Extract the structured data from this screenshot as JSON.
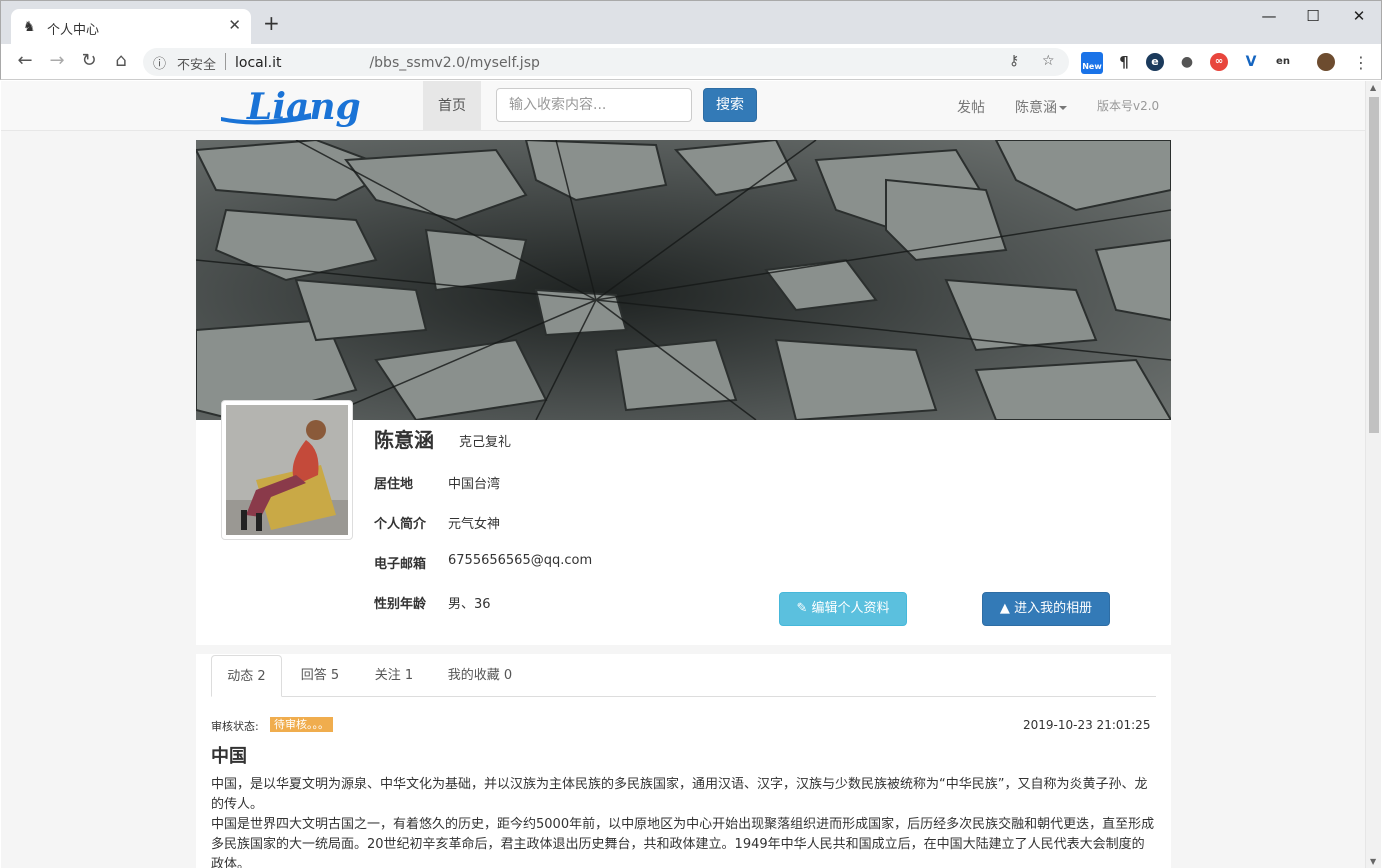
{
  "browser": {
    "tab_title": "个人中心",
    "new_tab": "+",
    "win_minimize": "—",
    "win_maximize": "☐",
    "win_close": "✕",
    "tab_close": "✕",
    "nav_back": "←",
    "nav_forward": "→",
    "nav_reload": "↻",
    "nav_home": "⌂",
    "insecure_label": "不安全",
    "url_host": "local.it",
    "url_path": "/bbs_ssmv2.0/myself.jsp",
    "info_icon": "ⓘ",
    "key_icon": "⚷",
    "star_icon": "☆",
    "menu_icon": "⋮",
    "ext_new_label": "New"
  },
  "navbar": {
    "logo_text": "Liang",
    "home": "首页",
    "search_placeholder": "输入收索内容...",
    "search_button": "搜索",
    "post": "发帖",
    "user": "陈意涵",
    "version": "版本号v2.0"
  },
  "profile": {
    "name": "陈意涵",
    "motto": "克己复礼",
    "fields": [
      {
        "label": "居住地",
        "value": "中国台湾"
      },
      {
        "label": "个人简介",
        "value": "元气女神"
      },
      {
        "label": "电子邮箱",
        "value": "6755656565@qq.com"
      },
      {
        "label": "性别年龄",
        "value": "男、36"
      }
    ],
    "edit_button": "编辑个人资料",
    "album_button": "进入我的相册",
    "edit_icon": "✎",
    "album_icon": "▲"
  },
  "posts": {
    "tabs": [
      {
        "label": "动态 2",
        "active": true
      },
      {
        "label": "回答 5",
        "active": false
      },
      {
        "label": "关注 1",
        "active": false
      },
      {
        "label": "我的收藏 0",
        "active": false
      }
    ],
    "status_label": "审核状态:",
    "status_value": "待审核。。。",
    "date": "2019-10-23 21:01:25",
    "title": "中国",
    "body_1": "中国，是以华夏文明为源泉、中华文化为基础，并以汉族为主体民族的多民族国家，通用汉语、汉字，汉族与少数民族被统称为“中华民族”，又自称为炎黄子孙、龙的传人。",
    "body_2": "中国是世界四大文明古国之一，有着悠久的历史，距今约5000年前，以中原地区为中心开始出现聚落组织进而形成国家，后历经多次民族交融和朝代更迭，直至形成多民族国家的大一统局面。20世纪初辛亥革命后，君主政体退出历史舞台，共和政体建立。1949年中华人民共和国成立后，在中国大陆建立了人民代表大会制度的政体。"
  }
}
